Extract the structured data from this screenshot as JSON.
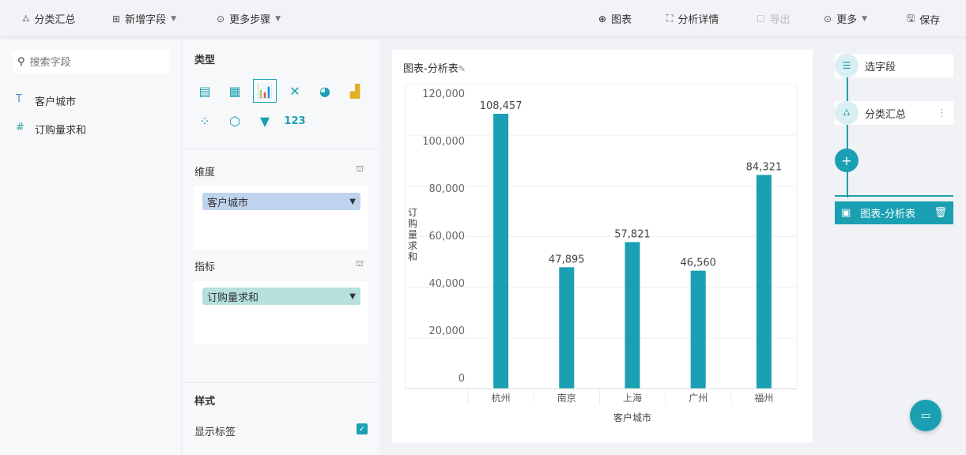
{
  "toolbar": {
    "group": "分类汇总",
    "add_field": "新增字段",
    "more_steps": "更多步骤",
    "chart": "图表",
    "detail": "分析详情",
    "export": "导出",
    "more": "更多",
    "save": "保存"
  },
  "fields": {
    "search_placeholder": "搜索字段",
    "items": [
      {
        "type": "T",
        "label": "客户城市"
      },
      {
        "type": "#",
        "label": "订购量求和"
      }
    ]
  },
  "config": {
    "type_label": "类型",
    "dimension_label": "维度",
    "dimension_value": "客户城市",
    "measure_label": "指标",
    "measure_value": "订购量求和",
    "style_label": "样式",
    "show_labels": "显示标签",
    "show_labels_checked": true,
    "numeric_icon": "123"
  },
  "card_title": "图表-分析表",
  "steps": {
    "select": "选字段",
    "group": "分类汇总",
    "current": "图表-分析表"
  },
  "colors": {
    "accent": "#1aa0b2",
    "dim_pill": "#c0d3ee",
    "measure_pill": "#b5e0dc"
  },
  "chart_data": {
    "type": "bar",
    "categories": [
      "杭州",
      "南京",
      "上海",
      "广州",
      "福州"
    ],
    "values": [
      108457,
      47895,
      57821,
      46560,
      84321
    ],
    "value_labels": [
      "108,457",
      "47,895",
      "57,821",
      "46,560",
      "84,321"
    ],
    "xlabel": "客户城市",
    "ylabel": "订购量求和",
    "ylim": [
      0,
      120000
    ],
    "yticks": [
      0,
      20000,
      40000,
      60000,
      80000,
      100000,
      120000
    ],
    "ytick_labels": [
      "0",
      "20,000",
      "40,000",
      "60,000",
      "80,000",
      "100,000",
      "120,000"
    ],
    "grid": true
  }
}
